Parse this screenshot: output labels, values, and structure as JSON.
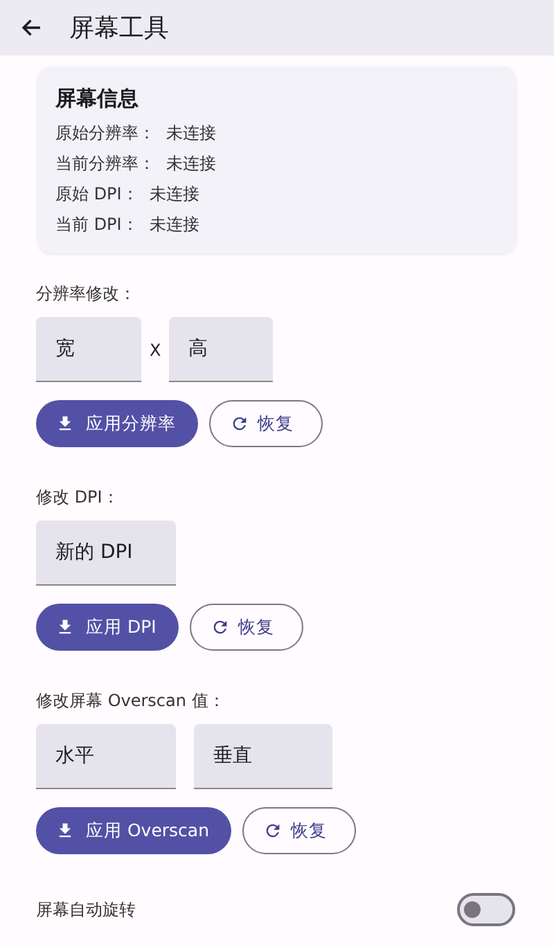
{
  "top_bar": {
    "title": "屏幕工具"
  },
  "info_card": {
    "title": "屏幕信息",
    "rows": [
      {
        "label": "原始分辨率：",
        "value": "未连接"
      },
      {
        "label": "当前分辨率：",
        "value": "未连接"
      },
      {
        "label": "原始 DPI：",
        "value": "未连接"
      },
      {
        "label": "当前 DPI：",
        "value": "未连接"
      }
    ]
  },
  "sections": [
    {
      "label": "分辨率修改：",
      "fields": [
        {
          "placeholder": "宽"
        },
        {
          "placeholder": "高"
        }
      ],
      "separator": "X",
      "apply_button": "应用分辨率",
      "restore_button": "恢复"
    },
    {
      "label": "修改 DPI：",
      "fields": [
        {
          "placeholder": "新的 DPI"
        }
      ],
      "apply_button": "应用 DPI",
      "restore_button": "恢复"
    },
    {
      "label": "修改屏幕 Overscan 值：",
      "fields": [
        {
          "placeholder": "水平"
        },
        {
          "placeholder": "垂直"
        }
      ],
      "apply_button": "应用 Overscan",
      "restore_button": "恢复"
    }
  ],
  "auto_rotate": {
    "label": "屏幕自动旋转",
    "on": false
  }
}
